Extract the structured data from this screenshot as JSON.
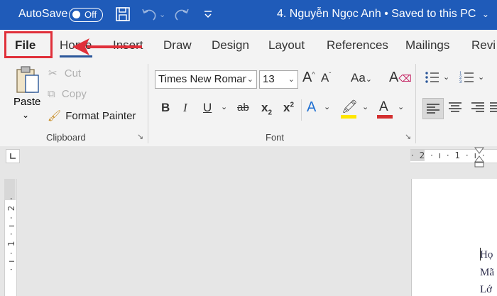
{
  "titlebar": {
    "autosave_label": "AutoSave",
    "autosave_state": "Off",
    "document_title": "4. Nguyễn Ngọc Anh • Saved to this PC",
    "title_dropdown": "⌄"
  },
  "tabs": [
    "File",
    "Home",
    "Insert",
    "Draw",
    "Design",
    "Layout",
    "References",
    "Mailings",
    "Revi"
  ],
  "clipboard": {
    "paste_label": "Paste",
    "cut_label": "Cut",
    "copy_label": "Copy",
    "format_painter_label": "Format Painter",
    "group_label": "Clipboard"
  },
  "font": {
    "font_name": "Times New Roman",
    "font_size": "13",
    "group_label": "Font",
    "colors": {
      "highlight": "#ffe600",
      "font_color": "#d32f2f",
      "accent": "#1f5bb9",
      "annotation": "#e0303a"
    }
  },
  "ruler": {
    "horizontal_marks": "· 2 · ı · 1 · ı ·",
    "vertical_marks": "· ı · 1 · ı · 2 ·"
  },
  "document": {
    "lines": [
      "Họ",
      "Mã",
      "Lớ"
    ]
  }
}
